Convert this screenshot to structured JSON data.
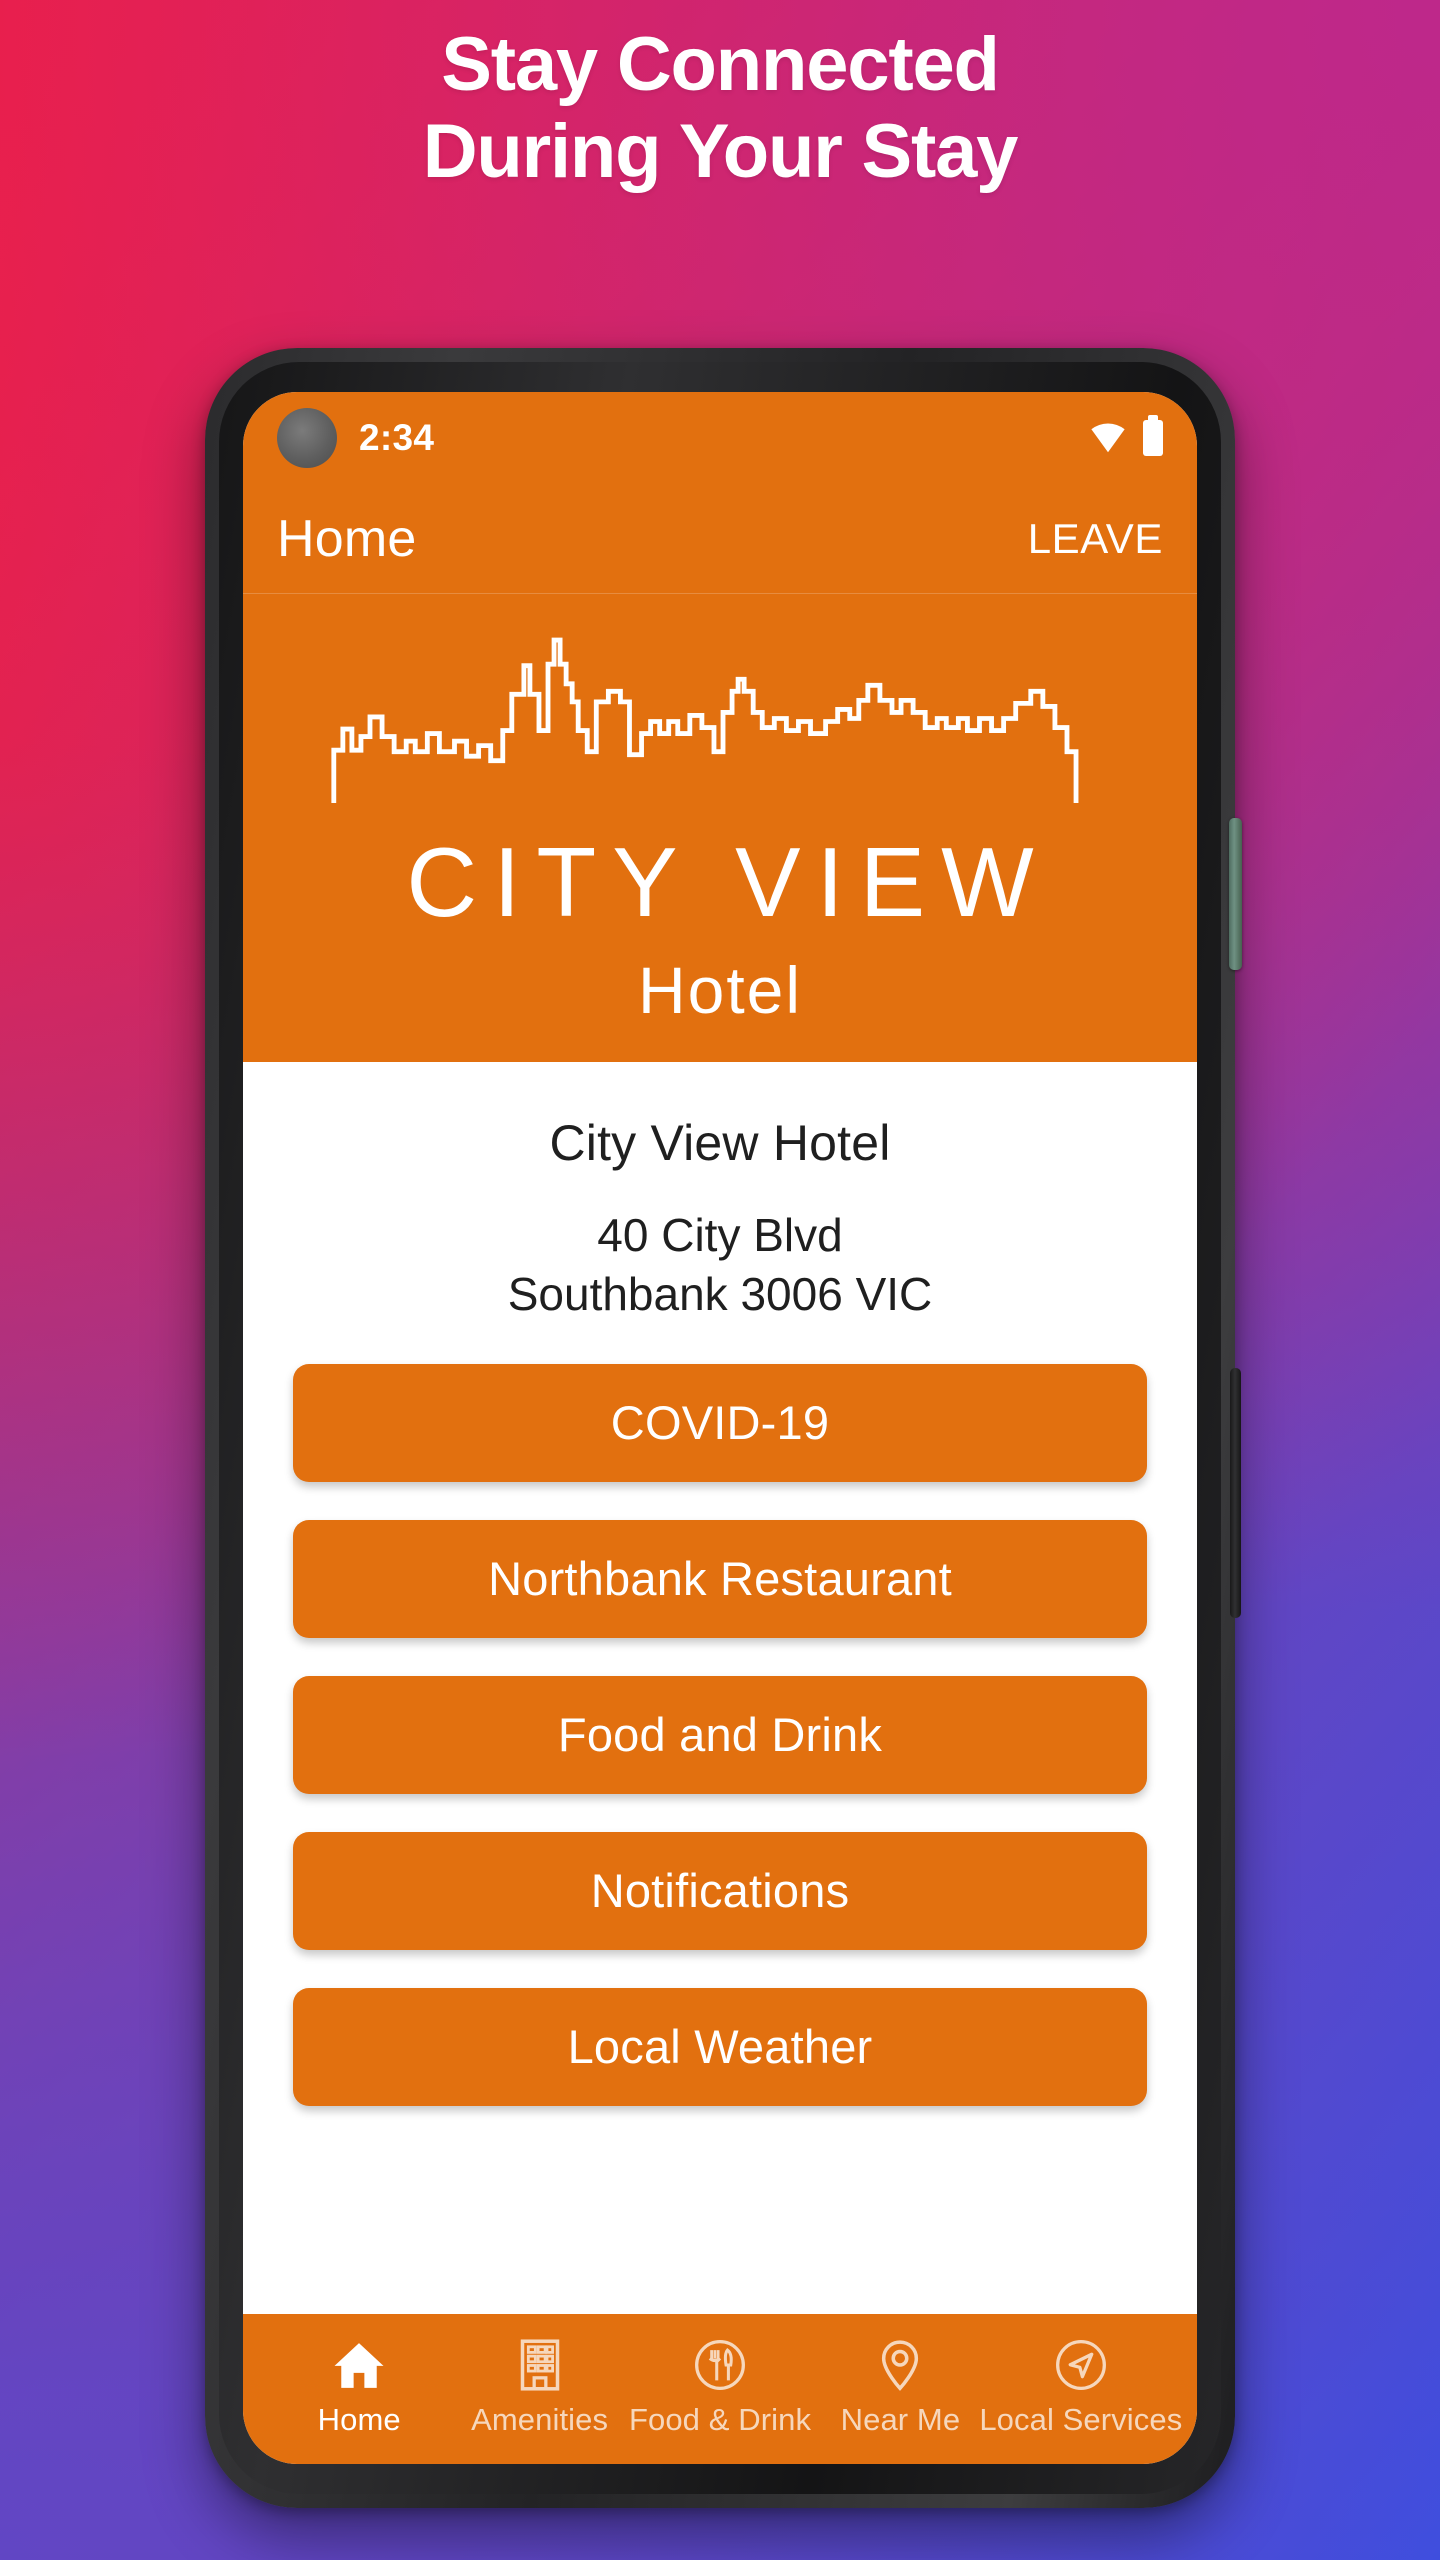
{
  "promo": {
    "headline_line1": "Stay Connected",
    "headline_line2": "During Your Stay",
    "background_colors": {
      "top_left": "#ED2049",
      "top_right": "#B1327F",
      "bottom_left": "#6146C4",
      "bottom_right": "#3650E5"
    }
  },
  "theme": {
    "brand_orange": "#E2700F",
    "on_brand": "#FFFFFF",
    "surface": "#FFFFFF",
    "text_primary": "#1F1F1F"
  },
  "statusbar": {
    "time": "2:34",
    "icons": [
      "wifi-icon",
      "battery-icon"
    ],
    "camera": "front-camera-punch-hole"
  },
  "appbar": {
    "title": "Home",
    "action_label": "LEAVE"
  },
  "hero": {
    "logo_graphic": "city-skyline-outline",
    "logo_title": "CITY VIEW",
    "logo_subtitle": "Hotel"
  },
  "main": {
    "hotel_name": "City View Hotel",
    "address_line1": "40 City Blvd",
    "address_line2": "Southbank 3006 VIC",
    "buttons": [
      {
        "label": "COVID-19"
      },
      {
        "label": "Northbank Restaurant"
      },
      {
        "label": "Food and Drink"
      },
      {
        "label": "Notifications"
      },
      {
        "label": "Local Weather"
      }
    ]
  },
  "bottom_nav": {
    "items": [
      {
        "label": "Home",
        "icon": "home-icon",
        "active": true
      },
      {
        "label": "Amenities",
        "icon": "building-icon",
        "active": false
      },
      {
        "label": "Food & Drink",
        "icon": "cutlery-circle-icon",
        "active": false
      },
      {
        "label": "Near Me",
        "icon": "map-pin-icon",
        "active": false
      },
      {
        "label": "Local Services",
        "icon": "navigation-arrow-circle-icon",
        "active": false
      }
    ]
  }
}
